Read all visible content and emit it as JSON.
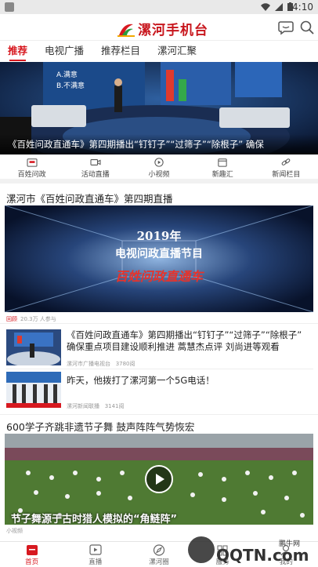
{
  "status": {
    "time": "4:10"
  },
  "app": {
    "title": "漯河手机台"
  },
  "tabs": [
    {
      "label": "推荐",
      "active": true
    },
    {
      "label": "电视广播",
      "active": false
    },
    {
      "label": "推荐栏目",
      "active": false
    },
    {
      "label": "漯河汇聚",
      "active": false
    }
  ],
  "banner": {
    "caption": "《百姓问政直通车》第四期播出“钉钉子”“过筛子”“除根子” 确保",
    "screen_text": [
      "A.满意",
      "B.不满意"
    ]
  },
  "shortcuts": [
    {
      "label": "百姓问政",
      "icon": "tv-box-icon"
    },
    {
      "label": "活动直播",
      "icon": "video-camera-icon"
    },
    {
      "label": "小视频",
      "icon": "play-circle-icon"
    },
    {
      "label": "新趣汇",
      "icon": "calendar-icon"
    },
    {
      "label": "新闻栏目",
      "icon": "link-icon"
    }
  ],
  "live": {
    "section_title": "漯河市《百姓问政直通车》第四期直播",
    "poster_line1": "2019年",
    "poster_line2": "电视问政直播节目",
    "poster_logo": "百姓问政直通车",
    "badge": "回顾",
    "views": "20.3万 人参与"
  },
  "news": [
    {
      "title": "《百姓问政直通车》第四期播出“钉钉子”“过筛子”“除根子” 确保重点项目建设顺利推进 蒿慧杰点评 刘尚进等观看",
      "source": "漯河市广播电视台",
      "count": "3780阅"
    },
    {
      "title": "昨天，他拨打了漯河第一个5G电话！",
      "source": "漯河新闻联播",
      "count": "3141阅"
    }
  ],
  "video2": {
    "section_title": "600学子齐跳非遗节子舞 鼓声阵阵气势恢宏",
    "overlay": "节子舞源于古时猎人模拟的“角鲢阵”",
    "source": "小视频"
  },
  "bottom_nav": [
    {
      "label": "首页",
      "active": true
    },
    {
      "label": "直播",
      "active": false
    },
    {
      "label": "漯河圈",
      "active": false
    },
    {
      "label": "服务",
      "active": false
    },
    {
      "label": "我的",
      "active": false
    }
  ],
  "watermark": {
    "line1": "鹏牛网",
    "line2": "QQTN.com"
  },
  "colors": {
    "accent": "#d71920",
    "bg": "#ffffff"
  }
}
